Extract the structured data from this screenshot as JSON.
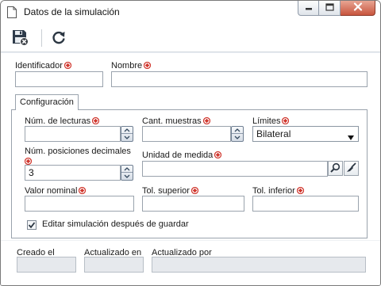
{
  "window": {
    "title": "Datos de la simulación",
    "icons": {
      "app": "document-icon"
    }
  },
  "toolbar": {
    "save_icon": "save-close-icon",
    "refresh_icon": "refresh-icon"
  },
  "form": {
    "identificador": {
      "label": "Identificador",
      "value": ""
    },
    "nombre": {
      "label": "Nombre",
      "value": ""
    },
    "tab": {
      "label": "Configuración"
    },
    "num_lecturas": {
      "label": "Núm. de lecturas",
      "value": ""
    },
    "cant_muestras": {
      "label": "Cant. muestras",
      "value": ""
    },
    "limites": {
      "label": "Límites",
      "selected": "Bilateral"
    },
    "num_posiciones": {
      "label": "Núm. posiciones decimales",
      "value": "3"
    },
    "unidad_medida": {
      "label": "Unidad de medida",
      "value": ""
    },
    "valor_nominal": {
      "label": "Valor nominal",
      "value": ""
    },
    "tol_superior": {
      "label": "Tol. superior",
      "value": ""
    },
    "tol_inferior": {
      "label": "Tol. inferior",
      "value": ""
    },
    "editar_check": {
      "label": "Editar simulación después de guardar",
      "checked": true
    }
  },
  "footer": {
    "creado_el": {
      "label": "Creado el",
      "value": ""
    },
    "actualizado_en": {
      "label": "Actualizado en",
      "value": ""
    },
    "actualizado_por": {
      "label": "Actualizado por",
      "value": ""
    }
  },
  "colors": {
    "required_marker": "#d0352c",
    "close_button": "#c8553e",
    "panel_border": "#9aa3ad"
  }
}
